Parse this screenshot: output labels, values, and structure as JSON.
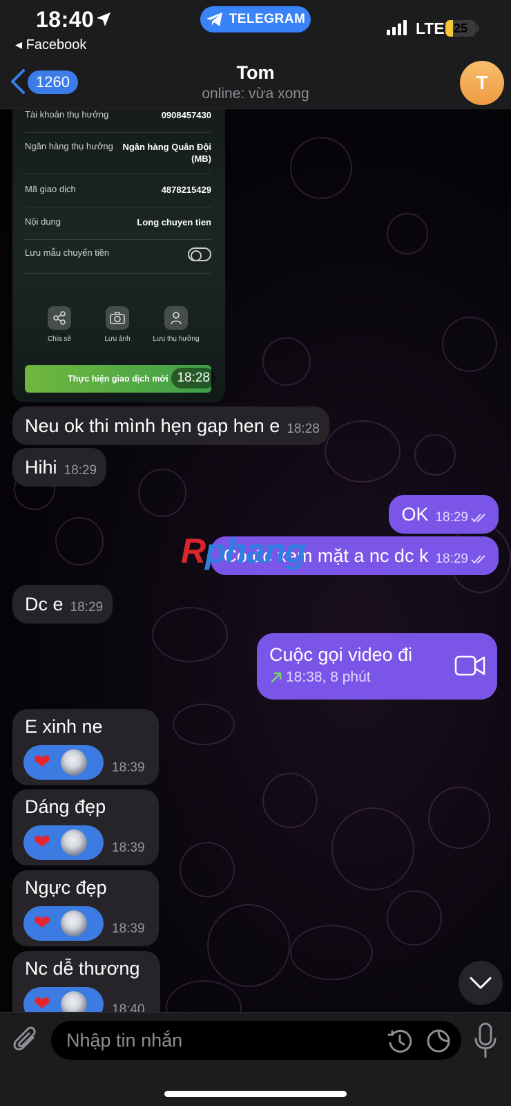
{
  "status_bar": {
    "time": "18:40",
    "back_app": "◂ Facebook",
    "pill_label": "TELEGRAM",
    "network": "LTE",
    "battery": "25",
    "battery_level": 0.25
  },
  "header": {
    "back_count": "1260",
    "title": "Tom",
    "subtitle": "online: vừa xong",
    "avatar_letter": "T"
  },
  "receipt": {
    "rows": [
      {
        "label": "Tài khoản thụ hưởng",
        "value": "0908457430"
      },
      {
        "label": "Ngân hàng thụ hưởng",
        "value": "Ngân hàng Quân Đội (MB)"
      },
      {
        "label": "Mã giao dịch",
        "value": "4878215429"
      },
      {
        "label": "Nội dung",
        "value": "Long chuyen tien"
      },
      {
        "label": "Lưu mẫu chuyển tiền",
        "value": ""
      }
    ],
    "actions": [
      {
        "label": "Chia sẻ",
        "icon": "share-icon"
      },
      {
        "label": "Lưu ảnh",
        "icon": "camera-icon"
      },
      {
        "label": "Lưu thụ hưởng",
        "icon": "person-icon"
      }
    ],
    "button_label": "Thực hiện giao dịch mới",
    "time": "18:28"
  },
  "messages": [
    {
      "dir": "in",
      "text": "Neu ok thi mình hẹn gap hen e",
      "time": "18:28"
    },
    {
      "dir": "in",
      "text": "Hihi",
      "time": "18:29"
    },
    {
      "dir": "out",
      "text": "OK",
      "time": "18:29"
    },
    {
      "dir": "out",
      "text": "Có đc xem mặt a nc dc k",
      "time": "18:29"
    },
    {
      "dir": "in",
      "text": "Dc e",
      "time": "18:29"
    }
  ],
  "call": {
    "title": "Cuộc gọi video đi",
    "detail": "18:38, 8 phút",
    "icon": "video-camera-icon"
  },
  "reaction_messages": [
    {
      "text": "E xinh ne",
      "reaction": "❤",
      "time": "18:39"
    },
    {
      "text": "Dáng đẹp",
      "reaction": "❤",
      "time": "18:39"
    },
    {
      "text": "Ngực đẹp",
      "reaction": "❤",
      "time": "18:39"
    },
    {
      "text": "Nc dễ thương",
      "reaction": "❤",
      "time": "18:40"
    }
  ],
  "watermark": {
    "part1": "R",
    "part2": "phang"
  },
  "input": {
    "placeholder": "Nhập tin nhắn"
  },
  "colors": {
    "accent": "#3b7ce8",
    "outgoing_bubble": "#7b55e8",
    "incoming_bubble": "#262429",
    "battery": "#f4c73b",
    "heart": "#e8242b"
  }
}
